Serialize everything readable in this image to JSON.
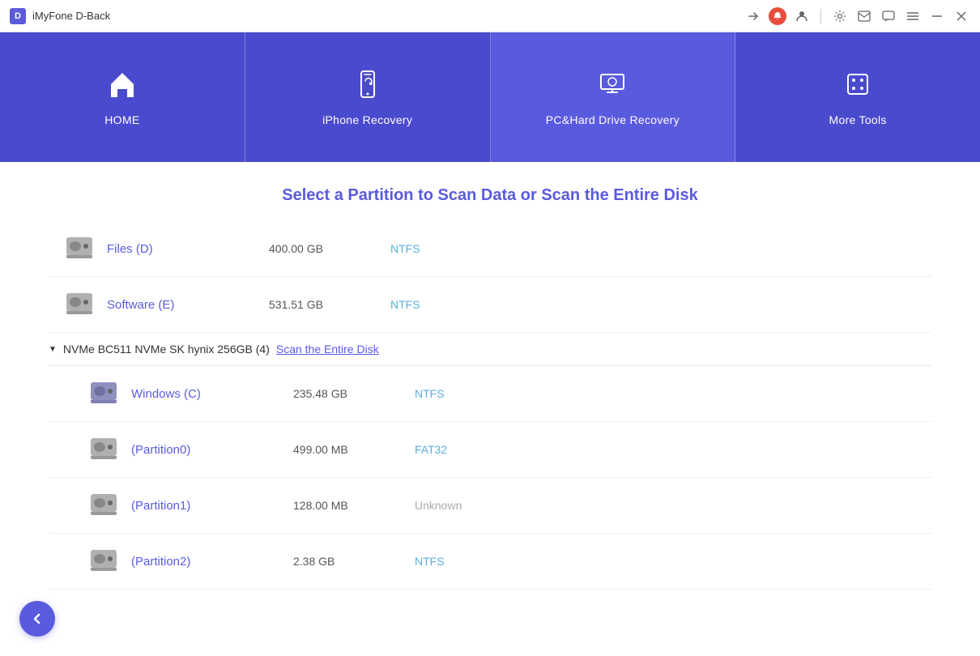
{
  "app": {
    "logo_letter": "D",
    "title": "iMyFone D-Back"
  },
  "titlebar": {
    "controls": [
      "share-icon",
      "notification-icon",
      "user-icon",
      "settings-icon",
      "mail-icon",
      "chat-icon",
      "menu-icon",
      "minimize-icon",
      "close-icon"
    ]
  },
  "navbar": {
    "items": [
      {
        "id": "home",
        "label": "HOME",
        "icon": "home"
      },
      {
        "id": "iphone-recovery",
        "label": "iPhone Recovery",
        "icon": "iphone"
      },
      {
        "id": "pc-recovery",
        "label": "PC&Hard Drive Recovery",
        "icon": "pc",
        "active": true
      },
      {
        "id": "more-tools",
        "label": "More Tools",
        "icon": "grid"
      }
    ]
  },
  "main": {
    "page_title": "Select a Partition to Scan Data or Scan the Entire Disk",
    "disk_groups": [
      {
        "id": "generic-hdd",
        "show_header": false,
        "partitions": [
          {
            "name": "Files (D)",
            "size": "400.00 GB",
            "fs": "NTFS",
            "icon_type": "normal"
          },
          {
            "name": "Software (E)",
            "size": "531.51 GB",
            "fs": "NTFS",
            "icon_type": "normal"
          }
        ]
      },
      {
        "id": "nvme",
        "show_header": true,
        "group_name": "NVMe BC511 NVMe SK hynix 256GB (4)",
        "scan_entire_label": "Scan the Entire Disk",
        "partitions": [
          {
            "name": "Windows (C)",
            "size": "235.48 GB",
            "fs": "NTFS",
            "icon_type": "win"
          },
          {
            "name": "(Partition0)",
            "size": "499.00 MB",
            "fs": "FAT32",
            "icon_type": "normal"
          },
          {
            "name": "(Partition1)",
            "size": "128.00 MB",
            "fs": "Unknown",
            "icon_type": "normal"
          },
          {
            "name": "(Partition2)",
            "size": "2.38 GB",
            "fs": "NTFS",
            "icon_type": "normal"
          }
        ]
      }
    ],
    "back_button_label": "←"
  }
}
